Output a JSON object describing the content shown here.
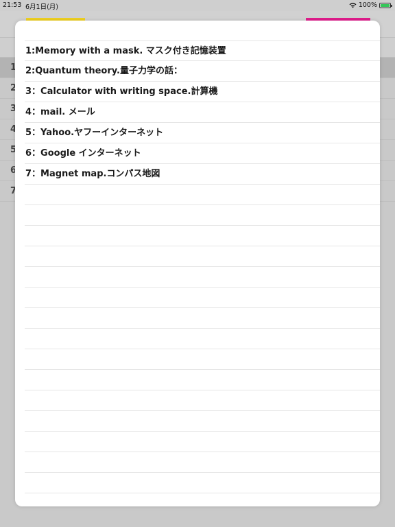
{
  "status_bar": {
    "time": "21:53",
    "date": "6月1日(月)",
    "battery": "100%",
    "icons": [
      "wifi-icon",
      "battery-icon"
    ]
  },
  "background_list": {
    "row_numbers": [
      "1",
      "2",
      "3",
      "4",
      "5",
      "6",
      "7"
    ]
  },
  "sheet": {
    "accent_colors": {
      "left": "#f0d222",
      "right": "#e21d8d"
    },
    "items": [
      "1:Memory with a mask. マスク付き記憶装置",
      "2:Quantum theory.量子力学の話：",
      "3：Calculator with writing space.計算機",
      "4：mail. メール",
      "5：Yahoo.ヤフーインターネット",
      "6：Google インターネット",
      "7：Magnet map.コンパス地図"
    ],
    "empty_lines": 15
  }
}
